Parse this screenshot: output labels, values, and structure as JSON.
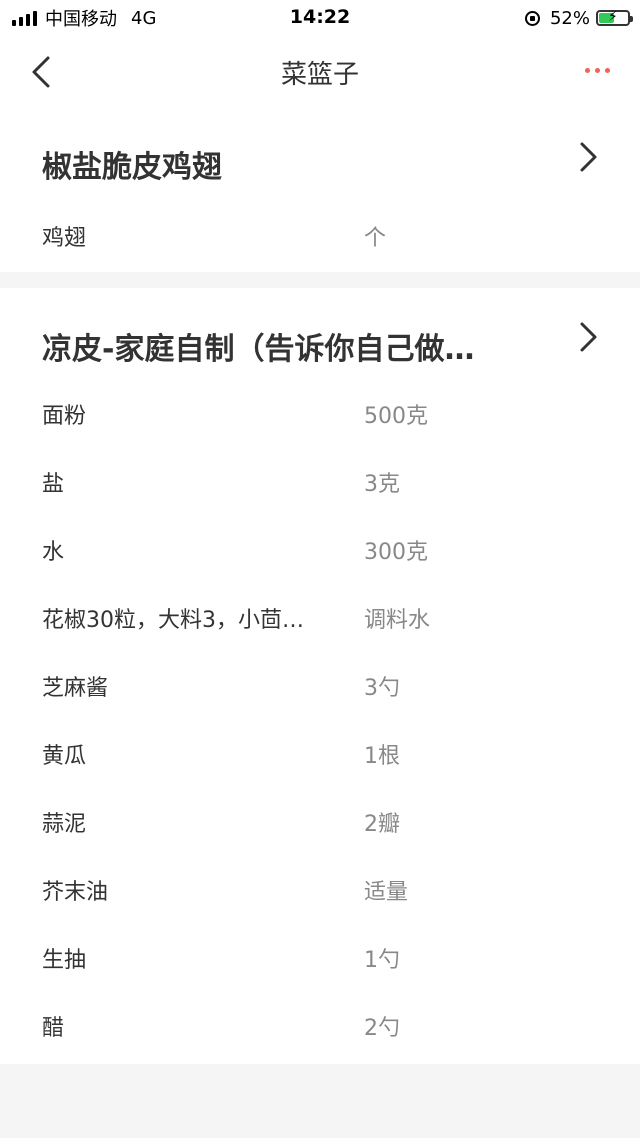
{
  "status_bar": {
    "carrier": "中国移动",
    "network": "4G",
    "time": "14:22",
    "battery_percent": "52%",
    "battery_level": 0.52,
    "battery_color": "#34c759"
  },
  "nav": {
    "title": "菜篮子",
    "back_icon": "chevron-left-icon",
    "more_icon": "more-dots-icon",
    "accent_color": "#f0625a"
  },
  "recipes": [
    {
      "title": "椒盐脆皮鸡翅",
      "ingredients": [
        {
          "name": "鸡翅",
          "qty": "个"
        }
      ]
    },
    {
      "title": "凉皮-家庭自制（告诉你自己做…",
      "ingredients": [
        {
          "name": "面粉",
          "qty": "500克"
        },
        {
          "name": "盐",
          "qty": "3克"
        },
        {
          "name": "水",
          "qty": "300克"
        },
        {
          "name": "花椒30粒，大料3，小茴…",
          "qty": "调料水"
        },
        {
          "name": "芝麻酱",
          "qty": "3勺"
        },
        {
          "name": "黄瓜",
          "qty": "1根"
        },
        {
          "name": "蒜泥",
          "qty": "2瓣"
        },
        {
          "name": "芥末油",
          "qty": "适量"
        },
        {
          "name": "生抽",
          "qty": "1勺"
        },
        {
          "name": "醋",
          "qty": "2勺"
        }
      ]
    }
  ]
}
